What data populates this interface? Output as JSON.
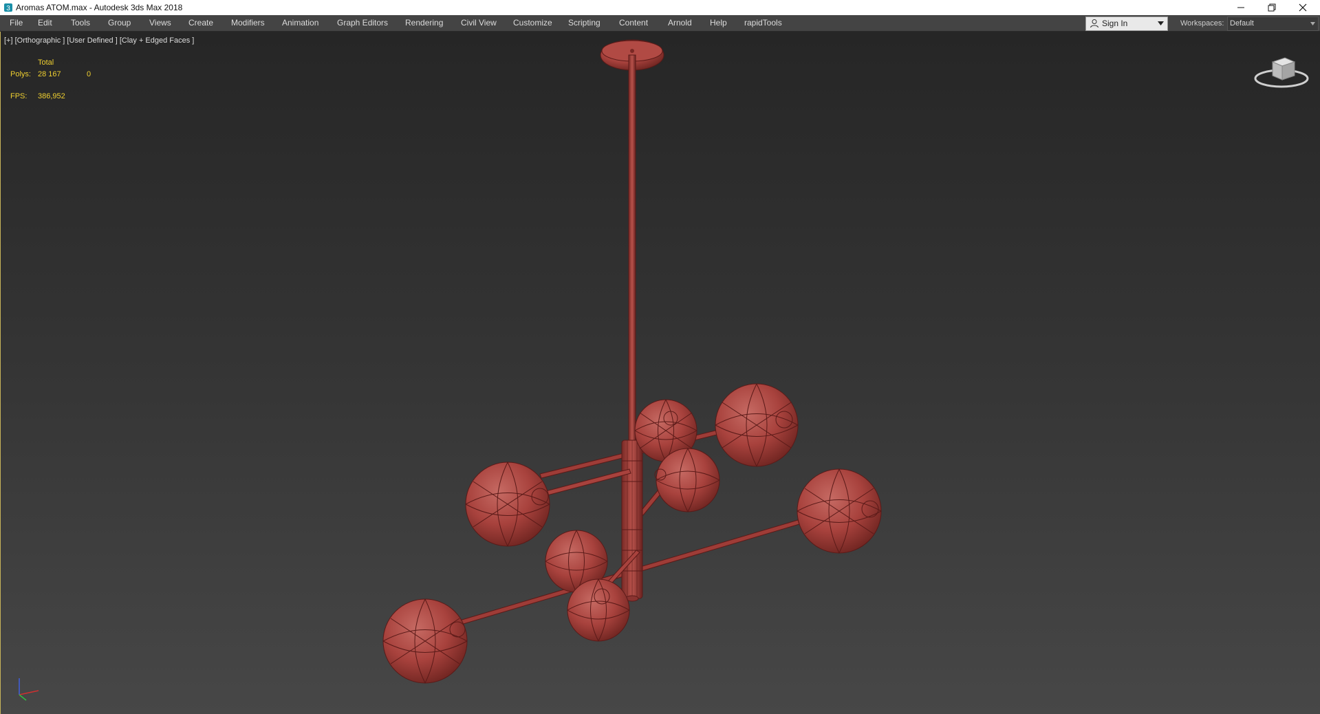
{
  "window": {
    "title": "Aromas ATOM.max - Autodesk 3ds Max 2018"
  },
  "menu": {
    "items": [
      "File",
      "Edit",
      "Tools",
      "Group",
      "Views",
      "Create",
      "Modifiers",
      "Animation",
      "Graph Editors",
      "Rendering",
      "Civil View",
      "Customize",
      "Scripting",
      "Content",
      "Arnold",
      "Help",
      "rapidTools"
    ]
  },
  "account": {
    "sign_in": "Sign In"
  },
  "workspaces": {
    "label": "Workspaces:",
    "value": "Default"
  },
  "viewport": {
    "label": "[+] [Orthographic ] [User Defined ] [Clay + Edged Faces ]",
    "stats": {
      "total_label": "Total",
      "polys_label": "Polys:",
      "polys_value": "28 167",
      "polys_selected": "0",
      "fps_label": "FPS:",
      "fps_value": "386,952"
    }
  },
  "colors": {
    "model": "#a8423d",
    "model_edge": "#5a1a18",
    "stats_text": "#f0d030",
    "active_border": "#c8b45a"
  },
  "icons": [
    "app-icon",
    "minimize-icon",
    "maximize-icon",
    "close-icon",
    "user-icon",
    "chevron-down-icon",
    "viewcube-icon",
    "axis-tripod-icon"
  ]
}
